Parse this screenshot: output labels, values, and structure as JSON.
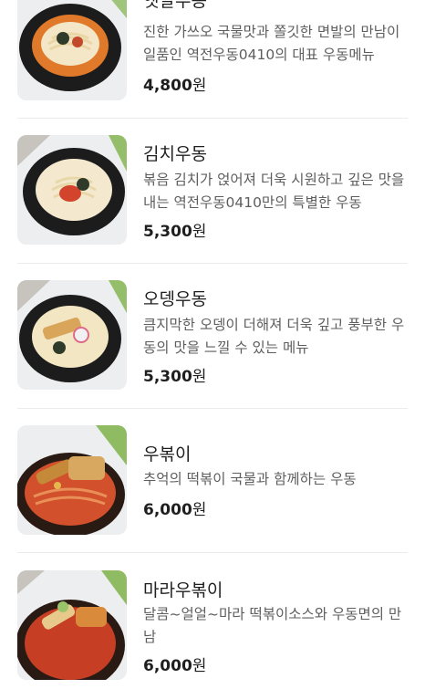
{
  "menu": {
    "items": [
      {
        "name": "옛날우동",
        "description": "진한 가쓰오 국물맛과 쫄깃한 면발의 만남이 일품인 역전우동0410의 대표 우동메뉴",
        "price": "4,800",
        "currency": "원",
        "image": "old-style-udon-photo"
      },
      {
        "name": "김치우동",
        "description": "볶음 김치가 얹어져 더욱 시원하고 깊은 맛을 내는 역전우동0410만의 특별한 우동",
        "price": "5,300",
        "currency": "원",
        "image": "kimchi-udon-photo"
      },
      {
        "name": "오뎅우동",
        "description": "큼지막한 오뎅이 더해져 더욱 깊고 풍부한 우동의 맛을 느낄 수 있는 메뉴",
        "price": "5,300",
        "currency": "원",
        "image": "fishcake-udon-photo"
      },
      {
        "name": "우볶이",
        "description": "추억의 떡볶이 국물과 함께하는 우동",
        "price": "6,000",
        "currency": "원",
        "image": "tteokbokki-udon-photo"
      },
      {
        "name": "마라우볶이",
        "description": "달콤~얼얼~마라 떡볶이소스와 우동면의 만남",
        "price": "6,000",
        "currency": "원",
        "image": "mala-tteokbokki-udon-photo"
      }
    ]
  }
}
